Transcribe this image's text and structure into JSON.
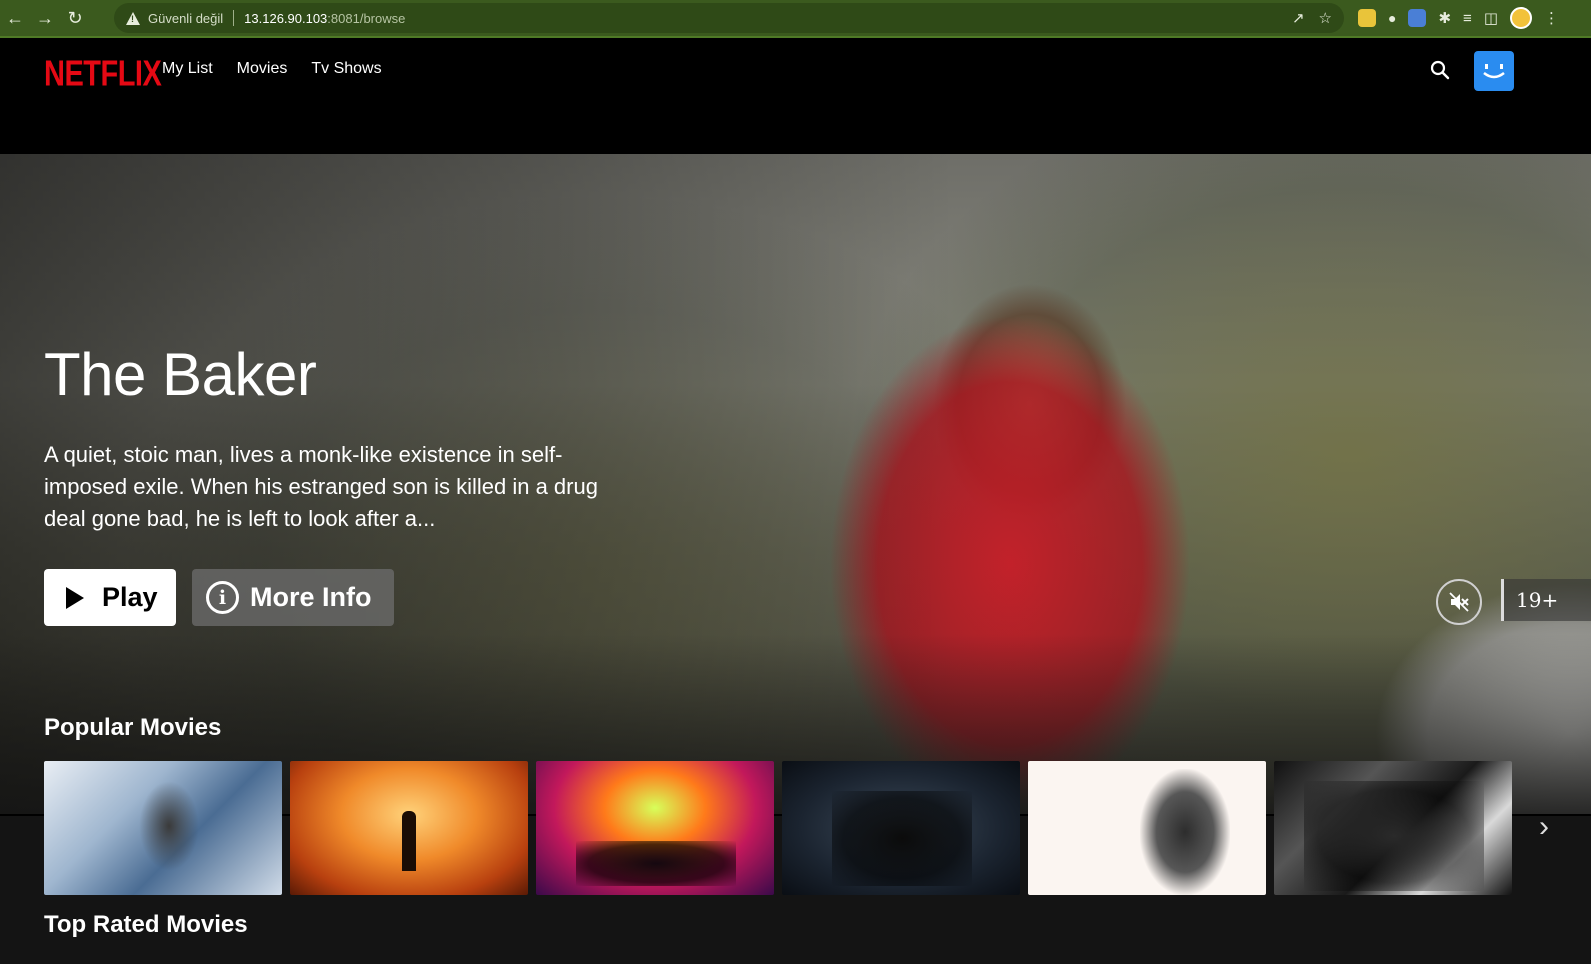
{
  "browser": {
    "not_secure": "Güvenli değil",
    "url_host": "13.126.90.103",
    "url_rest": ":8081/browse"
  },
  "nav": {
    "logo": "NETFLIX",
    "items": [
      {
        "label": "My List"
      },
      {
        "label": "Movies"
      },
      {
        "label": "Tv Shows"
      }
    ]
  },
  "hero": {
    "title": "The Baker",
    "description": "A quiet, stoic man, lives a monk-like existence in self-imposed exile. When his estranged son is killed in a drug deal gone bad, he is left to look after a...",
    "play_label": "Play",
    "info_label": "More Info",
    "maturity_rating": "19+"
  },
  "rows": [
    {
      "title": "Popular Movies"
    },
    {
      "title": "Top Rated Movies"
    }
  ],
  "colors": {
    "brand": "#e50914",
    "profile": "#2a8cf0",
    "browser_theme": "#3b5a1e"
  },
  "icons": {
    "search": "search-icon",
    "mute": "volume-off-icon",
    "next": "chevron-right-icon"
  }
}
